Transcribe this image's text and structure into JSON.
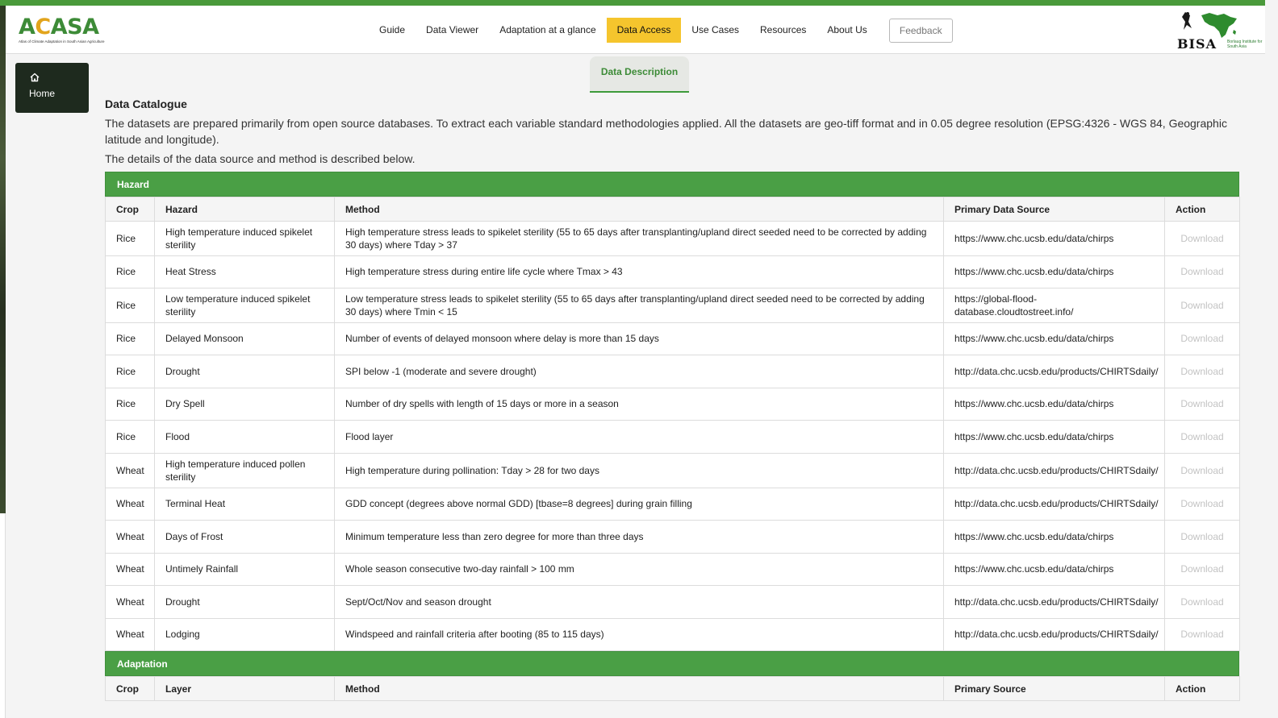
{
  "header": {
    "logo_text_a": "A",
    "logo_text_c": "C",
    "logo_text_rest": "ASA",
    "logo_subtitle": "Atlas of Climate Adaptation in South Asian Agriculture",
    "nav": [
      {
        "label": "Guide",
        "active": false
      },
      {
        "label": "Data Viewer",
        "active": false
      },
      {
        "label": "Adaptation at a glance",
        "active": false
      },
      {
        "label": "Data Access",
        "active": true
      },
      {
        "label": "Use Cases",
        "active": false
      },
      {
        "label": "Resources",
        "active": false
      },
      {
        "label": "About Us",
        "active": false
      }
    ],
    "feedback_label": "Feedback",
    "partner_logo_text": "BISA",
    "partner_logo_subtitle": "Borlaug Institute for South Asia"
  },
  "sidebar": {
    "home_label": "Home",
    "home_icon": "home-icon"
  },
  "tab": {
    "label": "Data Description"
  },
  "catalogue": {
    "title": "Data Catalogue",
    "paragraph": "The datasets are prepared primarily from open source databases. To extract each variable standard methodologies applied. All the datasets are geo-tiff format and in 0.05 degree resolution (EPSG:4326 - WGS 84, Geographic latitude and longitude).",
    "paragraph2": "The details of the data source and method is described below."
  },
  "hazard": {
    "section_title": "Hazard",
    "columns": [
      "Crop",
      "Hazard",
      "Method",
      "Primary Data Source",
      "Action"
    ],
    "rows": [
      {
        "crop": "Rice",
        "hazard": "High temperature induced spikelet sterility",
        "method": "High temperature stress leads to spikelet sterility (55 to 65 days after transplanting/upland direct seeded need to be corrected by adding 30 days) where Tday > 37",
        "source": "https://www.chc.ucsb.edu/data/chirps",
        "action": "Download"
      },
      {
        "crop": "Rice",
        "hazard": "Heat Stress",
        "method": "High temperature stress during entire life cycle where Tmax > 43",
        "source": "https://www.chc.ucsb.edu/data/chirps",
        "action": "Download"
      },
      {
        "crop": "Rice",
        "hazard": "Low temperature induced spikelet sterility",
        "method": "Low temperature stress leads to spikelet sterility (55 to 65 days after transplanting/upland direct seeded need to be corrected by adding 30 days) where Tmin < 15",
        "source": "https://global-flood-database.cloudtostreet.info/",
        "action": "Download"
      },
      {
        "crop": "Rice",
        "hazard": "Delayed Monsoon",
        "method": "Number of events of delayed monsoon where delay is more than 15 days",
        "source": "https://www.chc.ucsb.edu/data/chirps",
        "action": "Download"
      },
      {
        "crop": "Rice",
        "hazard": "Drought",
        "method": "SPI below -1 (moderate and severe drought)",
        "source": "http://data.chc.ucsb.edu/products/CHIRTSdaily/",
        "action": "Download"
      },
      {
        "crop": "Rice",
        "hazard": "Dry Spell",
        "method": "Number of dry spells with length of 15 days or more in a season",
        "source": "https://www.chc.ucsb.edu/data/chirps",
        "action": "Download"
      },
      {
        "crop": "Rice",
        "hazard": "Flood",
        "method": "Flood layer",
        "source": "https://www.chc.ucsb.edu/data/chirps",
        "action": "Download"
      },
      {
        "crop": "Wheat",
        "hazard": "High temperature induced pollen sterility",
        "method": "High temperature during pollination: Tday > 28 for two days",
        "source": "http://data.chc.ucsb.edu/products/CHIRTSdaily/",
        "action": "Download"
      },
      {
        "crop": "Wheat",
        "hazard": "Terminal Heat",
        "method": "GDD concept (degrees above normal GDD) [tbase=8 degrees] during grain filling",
        "source": "http://data.chc.ucsb.edu/products/CHIRTSdaily/",
        "action": "Download"
      },
      {
        "crop": "Wheat",
        "hazard": "Days of Frost",
        "method": "Minimum temperature less than zero degree for more than three days",
        "source": "https://www.chc.ucsb.edu/data/chirps",
        "action": "Download"
      },
      {
        "crop": "Wheat",
        "hazard": "Untimely Rainfall",
        "method": "Whole season consecutive two-day rainfall > 100 mm",
        "source": "https://www.chc.ucsb.edu/data/chirps",
        "action": "Download"
      },
      {
        "crop": "Wheat",
        "hazard": "Drought",
        "method": "Sept/Oct/Nov and season drought",
        "source": "http://data.chc.ucsb.edu/products/CHIRTSdaily/",
        "action": "Download"
      },
      {
        "crop": "Wheat",
        "hazard": "Lodging",
        "method": "Windspeed and rainfall criteria after booting (85 to 115 days)",
        "source": "http://data.chc.ucsb.edu/products/CHIRTSdaily/",
        "action": "Download"
      }
    ]
  },
  "adaptation": {
    "section_title": "Adaptation",
    "columns": [
      "Crop",
      "Layer",
      "Method",
      "Primary Source",
      "Action"
    ]
  },
  "colors": {
    "brand_green": "#4a9f45",
    "active_nav": "#f5c52d",
    "sidebar_dark": "#1e2a1e"
  }
}
